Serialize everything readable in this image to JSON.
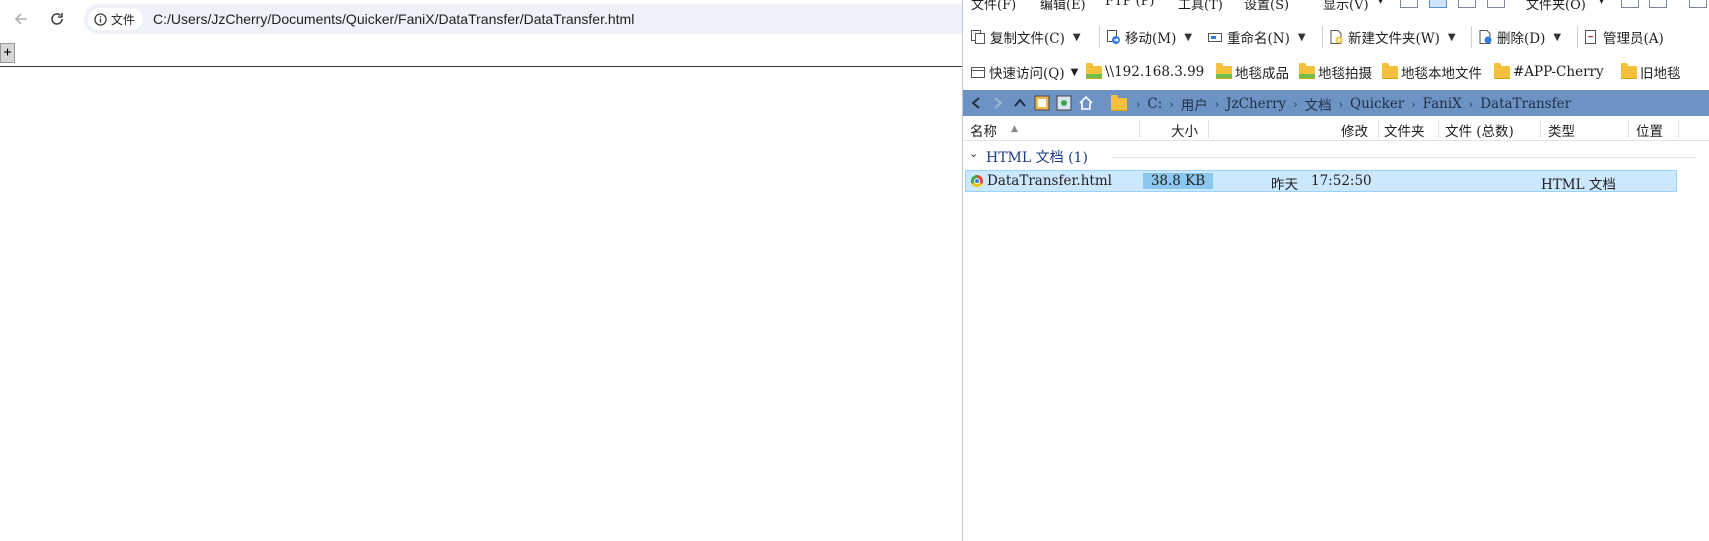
{
  "browser": {
    "chip_label": "文件",
    "url": "C:/Users/JzCherry/Documents/Quicker/FaniX/DataTransfer/DataTransfer.html",
    "plus_label": "+"
  },
  "explorer": {
    "menu": {
      "file": "文件(F)",
      "edit": "编辑(E)",
      "ftp": "FTP (P)",
      "tools": "工具(T)",
      "settings": "设置(S)",
      "display": "显示(V)",
      "folder": "文件夹(O)"
    },
    "toolbar": {
      "copy": "复制文件(C)",
      "move": "移动(M)",
      "rename": "重命名(N)",
      "new_folder": "新建文件夹(W)",
      "delete": "删除(D)",
      "admin": "管理员(A)"
    },
    "favorites": {
      "quick_access": "快速访问(Q)",
      "items": [
        "\\\\192.168.3.99",
        "地毯成品",
        "地毯拍摄",
        "地毯本地文件",
        "#APP-Cherry",
        "旧地毯"
      ]
    },
    "breadcrumb": [
      "C:",
      "用户",
      "JzCherry",
      "文档",
      "Quicker",
      "FaniX",
      "DataTransfer"
    ],
    "columns": {
      "name": "名称",
      "size": "大小",
      "modified": "修改",
      "folders": "文件夹",
      "files_total": "文件 (总数)",
      "type": "类型",
      "location": "位置"
    },
    "group": {
      "label": "HTML 文档 (1)"
    },
    "file": {
      "name": "DataTransfer.html",
      "size": "38.8 KB",
      "modified_day": "昨天",
      "modified_time": "17:52:50",
      "type": "HTML 文档"
    }
  }
}
